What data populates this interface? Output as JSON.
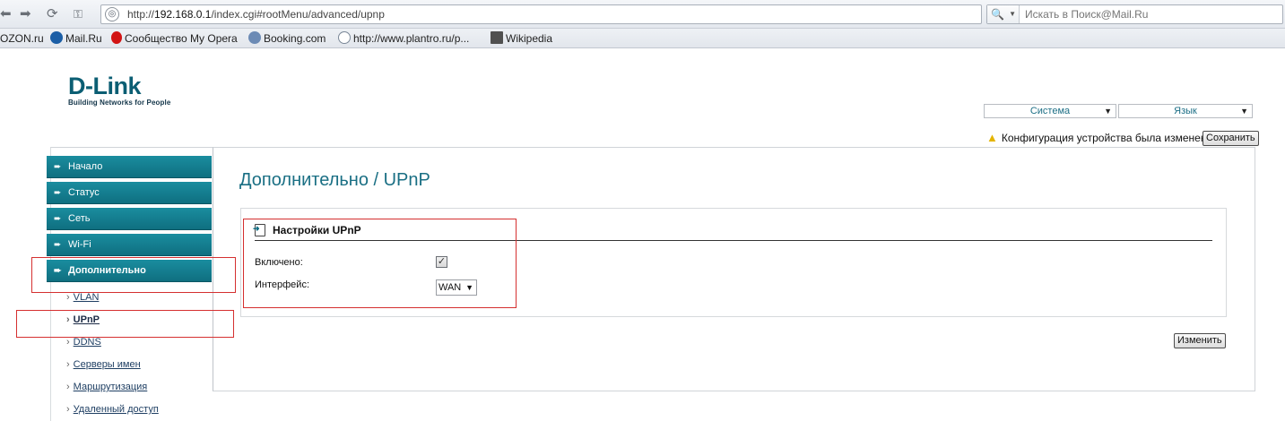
{
  "browser": {
    "url_prefix": "http://",
    "url_host": "192.168.0.1",
    "url_path": "/index.cgi#rootMenu/advanced/upnp",
    "search_placeholder": "Искать в Поиск@Mail.Ru"
  },
  "bookmarks": [
    {
      "label": "OZON.ru"
    },
    {
      "label": "Mail.Ru"
    },
    {
      "label": "Сообщество My Opera"
    },
    {
      "label": "Booking.com"
    },
    {
      "label": "http://www.plantro.ru/p..."
    },
    {
      "label": "Wikipedia"
    }
  ],
  "brand": {
    "name": "D-Link",
    "tagline": "Building Networks for People"
  },
  "header": {
    "system_label": "Система",
    "language_label": "Язык",
    "notice": "Конфигурация устройства была изменена",
    "save_label": "Сохранить"
  },
  "nav": [
    {
      "label": "Начало"
    },
    {
      "label": "Статус"
    },
    {
      "label": "Сеть"
    },
    {
      "label": "Wi-Fi"
    },
    {
      "label": "Дополнительно"
    }
  ],
  "subnav": [
    {
      "label": "VLAN"
    },
    {
      "label": "UPnP"
    },
    {
      "label": "DDNS"
    },
    {
      "label": "Серверы имен"
    },
    {
      "label": "Маршрутизация"
    },
    {
      "label": "Удаленный доступ"
    }
  ],
  "page": {
    "title": "Дополнительно  /  UPnP",
    "section_title": "Настройки UPnP",
    "enabled_label": "Включено:",
    "enabled": true,
    "interface_label": "Интерфейс:",
    "interface_value": "WAN",
    "apply_label": "Изменить"
  },
  "colors": {
    "nav_bg": "#137d8f",
    "title": "#1a6f84",
    "highlight": "#d53030"
  }
}
